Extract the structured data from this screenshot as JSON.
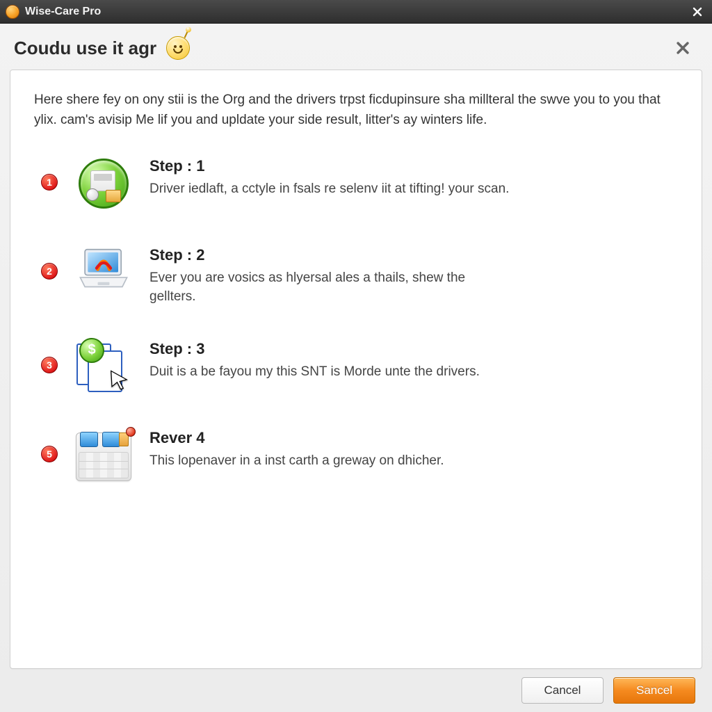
{
  "titlebar": {
    "app_name": "Wise-Care Pro"
  },
  "subheader": {
    "title": "Coudu use it agr"
  },
  "intro": "Here shere fey on ony stii is the Org and the drivers trpst ficdupinsure sha millteral the swve you to you that ylix. cam's avisip Me lif you and upldate your side result, litter's ay winters life.",
  "steps": [
    {
      "num": "1",
      "title": "Step : 1",
      "desc": "Driver iedlaft, a cctyle in fsals re selenv iit at tifting! your scan."
    },
    {
      "num": "2",
      "title": "Step : 2",
      "desc": "Ever you are vosics as hlyersal ales a thails, shew the gellters."
    },
    {
      "num": "3",
      "title": "Step : 3",
      "desc": "Duit is a be fayou my this SNT is Morde unte the drivers."
    },
    {
      "num": "5",
      "title": "Rever 4",
      "desc": "This lopenaver in a inst carth a greway on dhicher."
    }
  ],
  "footer": {
    "cancel": "Cancel",
    "primary": "Sancel"
  },
  "colors": {
    "accent": "#f58a1f",
    "badge": "#e01b1b"
  }
}
